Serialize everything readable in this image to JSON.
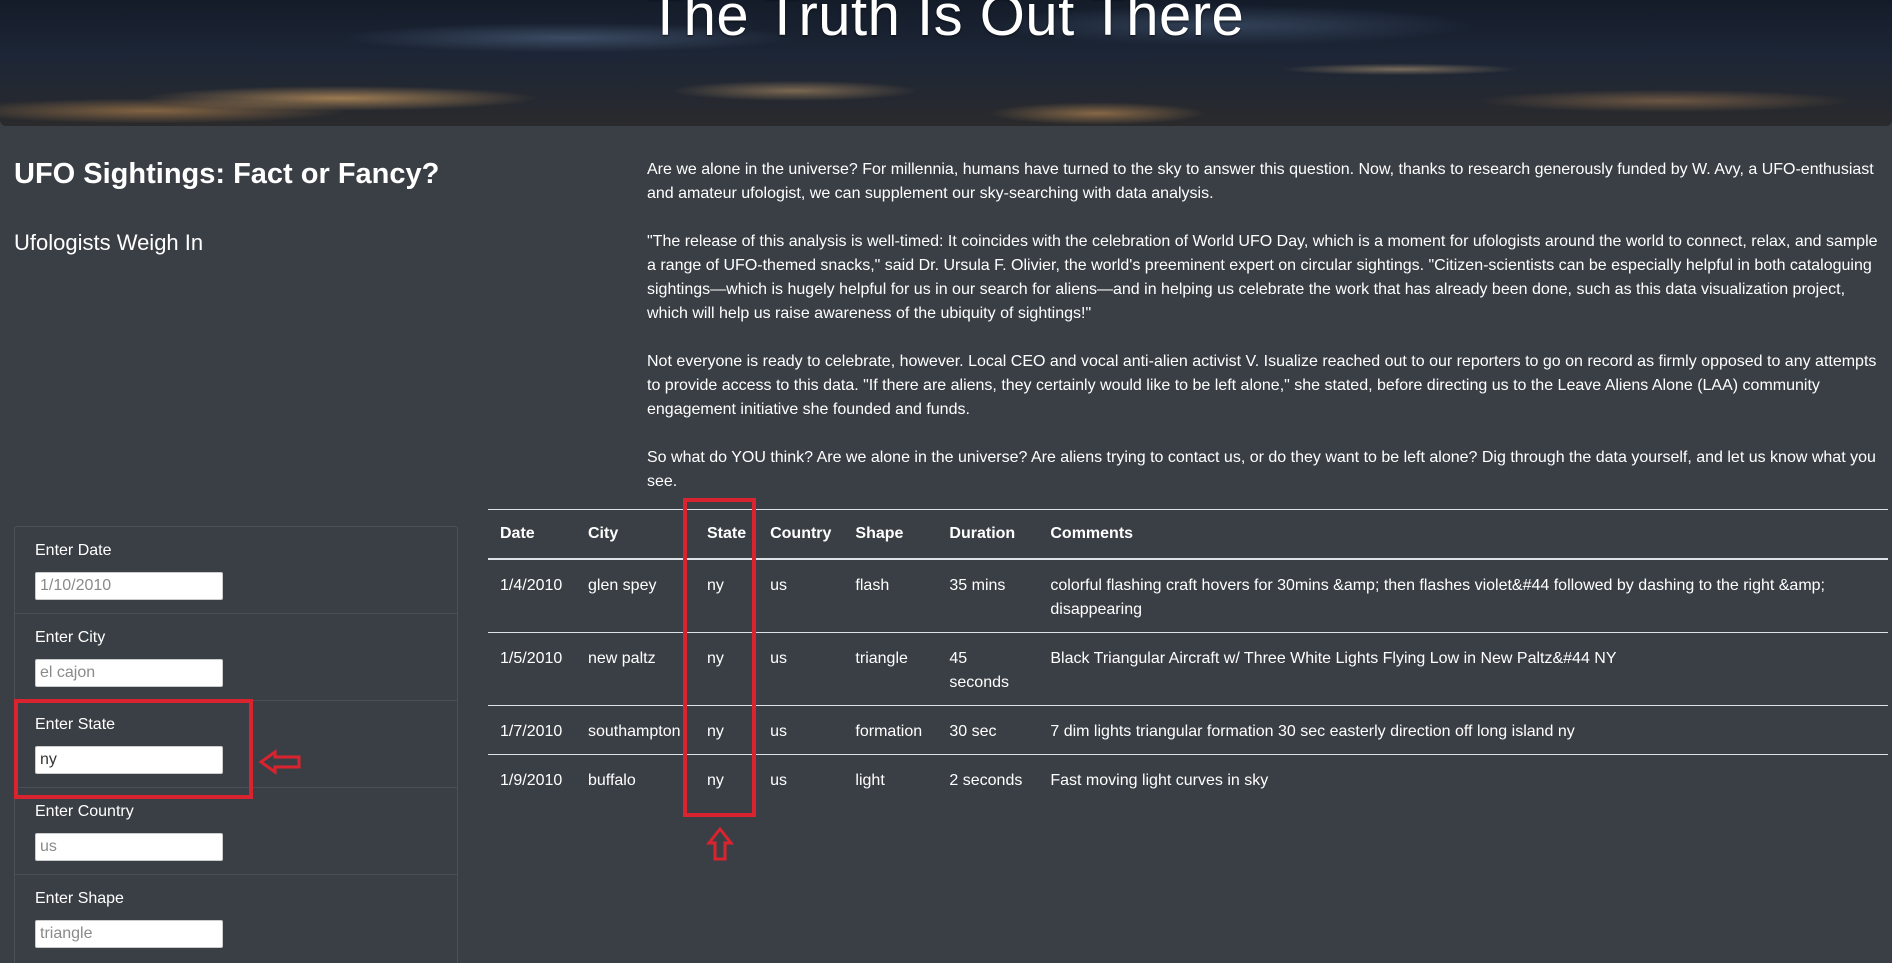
{
  "header": {
    "title": "The Truth Is Out There"
  },
  "left": {
    "title": "UFO Sightings: Fact or Fancy?",
    "subtitle": "Ufologists Weigh In"
  },
  "intro": {
    "paragraphs": [
      "Are we alone in the universe? For millennia, humans have turned to the sky to answer this question. Now, thanks to research generously funded by W. Avy, a UFO-enthusiast and amateur ufologist, we can supplement our sky-searching with data analysis.",
      "\"The release of this analysis is well-timed: It coincides with the celebration of World UFO Day, which is a moment for ufologists around the world to connect, relax, and sample a range of UFO-themed snacks,\" said Dr. Ursula F. Olivier, the world's preeminent expert on circular sightings. \"Citizen-scientists can be especially helpful in both cataloguing sightings—which is hugely helpful for us in our search for aliens—and in helping us celebrate the work that has already been done, such as this data visualization project, which will help us raise awareness of the ubiquity of sightings!\"",
      "Not everyone is ready to celebrate, however. Local CEO and vocal anti-alien activist V. Isualize reached out to our reporters to go on record as firmly opposed to any attempts to provide access to this data. \"If there are aliens, they certainly would like to be left alone,\" she stated, before directing us to the Leave Aliens Alone (LAA) community engagement initiative she founded and funds.",
      "So what do YOU think? Are we alone in the universe? Are aliens trying to contact us, or do they want to be left alone? Dig through the data yourself, and let us know what you see."
    ]
  },
  "filters": [
    {
      "label": "Enter Date",
      "value": "",
      "placeholder": "1/10/2010"
    },
    {
      "label": "Enter City",
      "value": "",
      "placeholder": "el cajon"
    },
    {
      "label": "Enter State",
      "value": "ny",
      "placeholder": "ny"
    },
    {
      "label": "Enter Country",
      "value": "",
      "placeholder": "us"
    },
    {
      "label": "Enter Shape",
      "value": "",
      "placeholder": "triangle"
    }
  ],
  "table": {
    "headers": [
      "Date",
      "City",
      "State",
      "Country",
      "Shape",
      "Duration",
      "Comments"
    ],
    "rows": [
      [
        "1/4/2010",
        "glen spey",
        "ny",
        "us",
        "flash",
        "35 mins",
        "colorful flashing craft hovers for 30mins &amp; then flashes violet&#44 followed by dashing to the right &amp; disappearing"
      ],
      [
        "1/5/2010",
        "new paltz",
        "ny",
        "us",
        "triangle",
        "45 seconds",
        "Black Triangular Aircraft w/ Three White Lights Flying Low in New Paltz&#44 NY"
      ],
      [
        "1/7/2010",
        "southampton",
        "ny",
        "us",
        "formation",
        "30 sec",
        "7 dim lights triangular formation 30 sec easterly direction off long island ny"
      ],
      [
        "1/9/2010",
        "buffalo",
        "ny",
        "us",
        "light",
        "2 seconds",
        "Fast moving light curves in sky"
      ]
    ]
  },
  "colors": {
    "background": "#3a3f45",
    "annotation": "#d9232e"
  }
}
